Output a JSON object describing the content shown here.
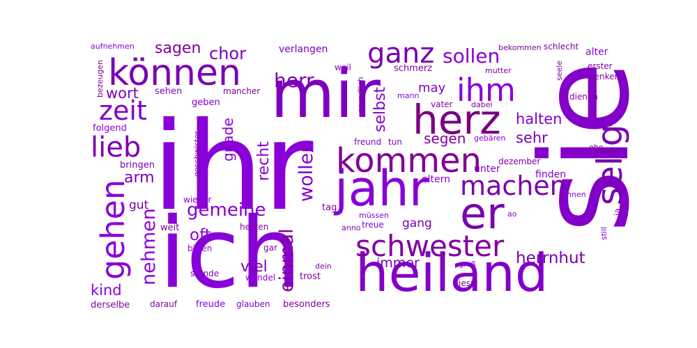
{
  "word_cloud": {
    "words": [
      {
        "text": "ihr",
        "color": "#8a00d9"
      },
      {
        "text": "sie",
        "color": "#8200c8"
      },
      {
        "text": "ich",
        "color": "#8800d8"
      },
      {
        "text": "mir",
        "color": "#7e00bf"
      },
      {
        "text": "heiland",
        "color": "#8200c8"
      },
      {
        "text": "jahr",
        "color": "#8800d8"
      },
      {
        "text": "können",
        "color": "#7c00b4"
      },
      {
        "text": "er",
        "color": "#7a00b0"
      },
      {
        "text": "herz",
        "color": "#790080"
      },
      {
        "text": "kommen",
        "color": "#800096"
      },
      {
        "text": "ihm",
        "color": "#8a00d9"
      },
      {
        "text": "ganz",
        "color": "#7a00b0"
      },
      {
        "text": "selig",
        "color": "#7a00b0"
      },
      {
        "text": "gehen",
        "color": "#8a00d9"
      },
      {
        "text": "schwester",
        "color": "#8000a0"
      },
      {
        "text": "machen",
        "color": "#7b00a8"
      },
      {
        "text": "zeit",
        "color": "#8200c8"
      },
      {
        "text": "lieb",
        "color": "#7c00b4"
      },
      {
        "text": "nehmen",
        "color": "#8a00d9"
      },
      {
        "text": "gemeine",
        "color": "#8500d0"
      },
      {
        "text": "sollen",
        "color": "#8800d8"
      },
      {
        "text": "herr",
        "color": "#7c00b4"
      },
      {
        "text": "wollen",
        "color": "#8500d0"
      },
      {
        "text": "einmal",
        "color": "#800096"
      },
      {
        "text": "herrnhut",
        "color": "#7a00b0"
      },
      {
        "text": "chor",
        "color": "#7c00b4"
      },
      {
        "text": "selbst",
        "color": "#8500d0"
      },
      {
        "text": "oft",
        "color": "#8a00d9"
      },
      {
        "text": "halten",
        "color": "#8200c8"
      },
      {
        "text": "sehr",
        "color": "#7a00b0"
      },
      {
        "text": "wort",
        "color": "#7c00b4"
      },
      {
        "text": "arm",
        "color": "#7c00b4"
      },
      {
        "text": "recht",
        "color": "#8800d8"
      },
      {
        "text": "gnade",
        "color": "#8800d8"
      },
      {
        "text": "viel",
        "color": "#7c00b4"
      },
      {
        "text": "kind",
        "color": "#8a00d9"
      },
      {
        "text": "immer",
        "color": "#7a00b0"
      },
      {
        "text": "segen",
        "color": "#8000a0"
      },
      {
        "text": "sagen",
        "color": "#800096"
      },
      {
        "text": "may",
        "color": "#8200c8"
      },
      {
        "text": "gang",
        "color": "#7c00b4"
      },
      {
        "text": "gut",
        "color": "#7c00b4"
      },
      {
        "text": "verlangen",
        "color": "#7c00b4"
      },
      {
        "text": "finden",
        "color": "#8200c8"
      },
      {
        "text": "unter",
        "color": "#8200c8"
      },
      {
        "text": "dezember",
        "color": "#8000a0"
      },
      {
        "text": "eltern",
        "color": "#8a00d9"
      },
      {
        "text": "schmerz",
        "color": "#8000a0"
      },
      {
        "text": "alter",
        "color": "#8a00d9"
      },
      {
        "text": "denken",
        "color": "#8000a0"
      },
      {
        "text": "dienen",
        "color": "#8000a0"
      },
      {
        "text": "erster",
        "color": "#8000a0"
      },
      {
        "text": "sehen",
        "color": "#8200c8"
      },
      {
        "text": "geben",
        "color": "#8200c8"
      },
      {
        "text": "folgend",
        "color": "#8a00d9"
      },
      {
        "text": "bringen",
        "color": "#7c00b4"
      },
      {
        "text": "bezeugen",
        "color": "#8000a0"
      },
      {
        "text": "aufnehmen",
        "color": "#8800d8"
      },
      {
        "text": "mancher",
        "color": "#8000a0"
      },
      {
        "text": "grundlich",
        "color": "#8000a0"
      },
      {
        "text": "weil",
        "color": "#8800d8"
      },
      {
        "text": "mann",
        "color": "#8800d8"
      },
      {
        "text": "mutter",
        "color": "#8000a0"
      },
      {
        "text": "bekommen",
        "color": "#8000a0"
      },
      {
        "text": "schlecht",
        "color": "#8000a0"
      },
      {
        "text": "seele",
        "color": "#8000a0"
      },
      {
        "text": "vater",
        "color": "#8000a0"
      },
      {
        "text": "dabei",
        "color": "#8000a0"
      },
      {
        "text": "geschwister",
        "color": "#8000a0"
      },
      {
        "text": "freund",
        "color": "#8200c8"
      },
      {
        "text": "tun",
        "color": "#8200c8"
      },
      {
        "text": "gebären",
        "color": "#8800d8"
      },
      {
        "text": "ehe",
        "color": "#8000a0"
      },
      {
        "text": "ihnen",
        "color": "#8a00d9"
      },
      {
        "text": "ja",
        "color": "#8200c8"
      },
      {
        "text": "wieder",
        "color": "#8800d8"
      },
      {
        "text": "tag",
        "color": "#8000a0"
      },
      {
        "text": "müssen",
        "color": "#8200c8"
      },
      {
        "text": "treue",
        "color": "#8a00d9"
      },
      {
        "text": "anno",
        "color": "#8000a0"
      },
      {
        "text": "herzen",
        "color": "#8000a0"
      },
      {
        "text": "weit",
        "color": "#8000a0"
      },
      {
        "text": "bitten",
        "color": "#8a00d9"
      },
      {
        "text": "gar",
        "color": "#8000a0"
      },
      {
        "text": "stunde",
        "color": "#8200c8"
      },
      {
        "text": "wandel",
        "color": "#8a00d9"
      },
      {
        "text": "dein",
        "color": "#8000a0"
      },
      {
        "text": "trost",
        "color": "#8000a0"
      },
      {
        "text": "groß",
        "color": "#8200c8"
      },
      {
        "text": "jesu",
        "color": "#8000a0"
      },
      {
        "text": "still",
        "color": "#8200c8"
      },
      {
        "text": "ao",
        "color": "#8800d8"
      },
      {
        "text": "derselbe",
        "color": "#8000a0"
      },
      {
        "text": "darauf",
        "color": "#8000a0"
      },
      {
        "text": "freude",
        "color": "#8a00d9"
      },
      {
        "text": "glauben",
        "color": "#8200c8"
      },
      {
        "text": "besonders",
        "color": "#8000a0"
      }
    ]
  }
}
